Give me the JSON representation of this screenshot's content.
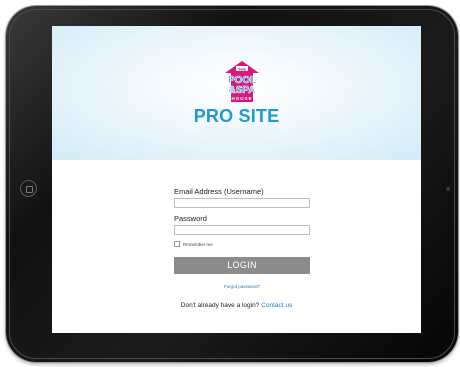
{
  "brand": {
    "logo_top": "THE",
    "logo_line1": "POOL",
    "logo_line2": "&SPA",
    "logo_line3": "HOUSE",
    "title": "PRO SITE",
    "title_color": "#1f9ad6",
    "logo_pink": "#d6197c"
  },
  "form": {
    "email_label": "Email Address (Username)",
    "email_value": "",
    "password_label": "Password",
    "password_value": "",
    "remember_label": "Remember me",
    "login_label": "LOGIN",
    "forgot_label": "Forgot password?",
    "no_login_text": "Don't already have a login?",
    "contact_label": "Contact us"
  },
  "colors": {
    "hero": "#d3ebf7",
    "button": "#8c8c8c",
    "link": "#1f7ac0"
  }
}
